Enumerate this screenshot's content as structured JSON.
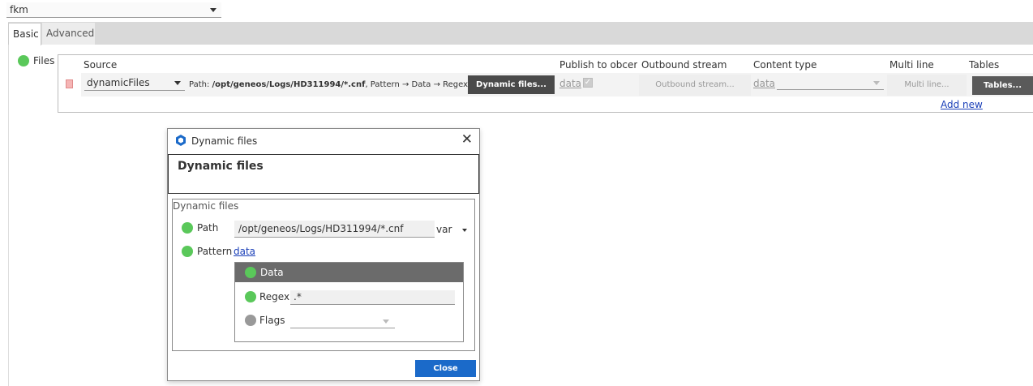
{
  "top_select": {
    "value": "fkm"
  },
  "tabs": [
    {
      "label": "Basic"
    },
    {
      "label": "Advanced"
    }
  ],
  "files_section": {
    "label": "Files",
    "columns": {
      "source": "Source",
      "publish": "Publish to obcerv",
      "outbound": "Outbound stream",
      "content_type": "Content type",
      "multi_line": "Multi line",
      "tables": "Tables"
    },
    "row": {
      "source_value": "dynamicFiles",
      "path_prefix": "Path: ",
      "path_value": "/opt/geneos/Logs/HD311994/*.cnf",
      "path_suffix": ", Pattern → Data → Regex: .*",
      "dynamic_files_button": "Dynamic files...",
      "publish_link": "data",
      "publish_checked": true,
      "outbound_button": "Outbound stream...",
      "content_type_link": "data",
      "content_type_value": "",
      "multi_line_button": "Multi line...",
      "tables_button": "Tables..."
    },
    "add_new": "Add new"
  },
  "dialog": {
    "title": "Dynamic files",
    "heading": "Dynamic files",
    "group_label": "Dynamic files",
    "path_label": "Path",
    "path_value": "/opt/geneos/Logs/HD311994/*.cnf",
    "path_type": "var",
    "pattern_label": "Pattern",
    "pattern_link": "data",
    "data_header": "Data",
    "regex_label": "Regex",
    "regex_value": ".*",
    "flags_label": "Flags",
    "flags_value": "",
    "close_button": "Close"
  },
  "colors": {
    "status_green": "#5ac85a",
    "status_grey": "#999999",
    "primary_button": "#1b6ac9",
    "dark_button": "#4a4a4a",
    "tab_bar": "#d9d9d9"
  }
}
